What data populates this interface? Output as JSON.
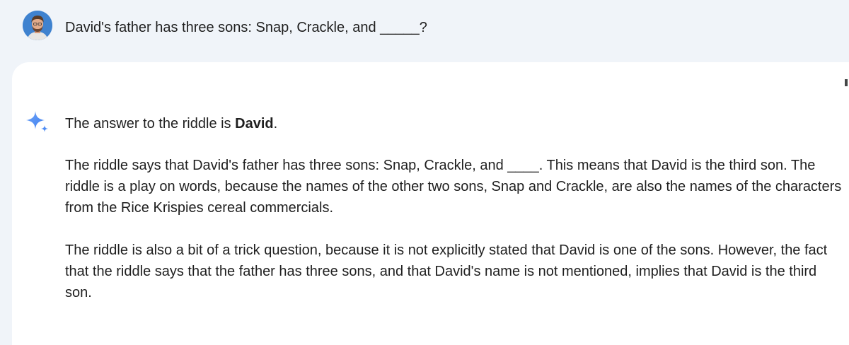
{
  "prompt": {
    "avatar_icon": "user-avatar",
    "text": "David's father has three sons: Snap, Crackle, and _____?"
  },
  "response": {
    "icon": "gemini-sparkle-icon",
    "answer_prefix": "The answer to the riddle is ",
    "answer_bold": "David",
    "answer_suffix": ".",
    "paragraph_2": "The riddle says that David's father has three sons: Snap, Crackle, and ____. This means that David is the third son. The riddle is a play on words, because the names of the other two sons, Snap and Crackle, are also the names of the characters from the Rice Krispies cereal commercials.",
    "paragraph_3": "The riddle is also a bit of a trick question, because it is not explicitly stated that David is one of the sons. However, the fact that the riddle says that the father has three sons, and that David's name is not mentioned, implies that David is the third son."
  },
  "colors": {
    "page_background": "#f0f4f9",
    "card_background": "#ffffff",
    "text": "#1f1f1f",
    "sparkle_blue": "#4f8df5"
  }
}
